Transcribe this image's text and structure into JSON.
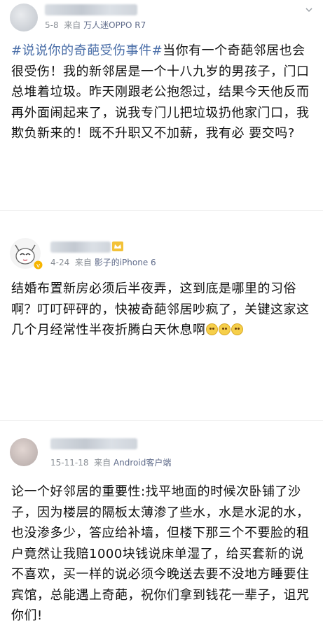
{
  "posts": [
    {
      "date": "5-8",
      "from": "来自",
      "source": "万人迷OPPO R7",
      "hashtag": "#说说你的奇葩受伤事件#",
      "text": "当你有一个奇葩邻居也会很受伤！我的新邻居是一个十八九岁的男孩子，门口总堆着垃圾。昨天刚跟老公抱怨过，结果今天他反而再外面闹起来了，说我专门儿把垃圾扔他家门口，我欺负新来的！既不升职又不加薪，我有必 要交吗?"
    },
    {
      "date": "4-24",
      "from": "来自",
      "source": "影子的iPhone 6",
      "text": "结婚布置新房必须后半夜弄，这到底是哪里的习俗啊？叮叮砰砰的，快被奇葩邻居吵疯了，关键这家这几个月经常性半夜折腾白天休息啊",
      "emoji_count": 3
    },
    {
      "date": "15-11-18",
      "from": "来自",
      "source": "Android客户端",
      "text": "论一个好邻居的重要性:找平地面的时候次卧铺了沙子，因为楼层的隔板太薄渗了些水，水是水泥的水，也没渗多少，答应给补墙，但楼下那三个不要脸的租户竟然让我赔1000块钱说床单湿了，给买套新的说不喜欢，买一样的说必须今晚送去要不没地方睡要住宾馆，总能遇上奇葩，祝你们拿到钱花一辈子，诅咒你们!"
    }
  ]
}
